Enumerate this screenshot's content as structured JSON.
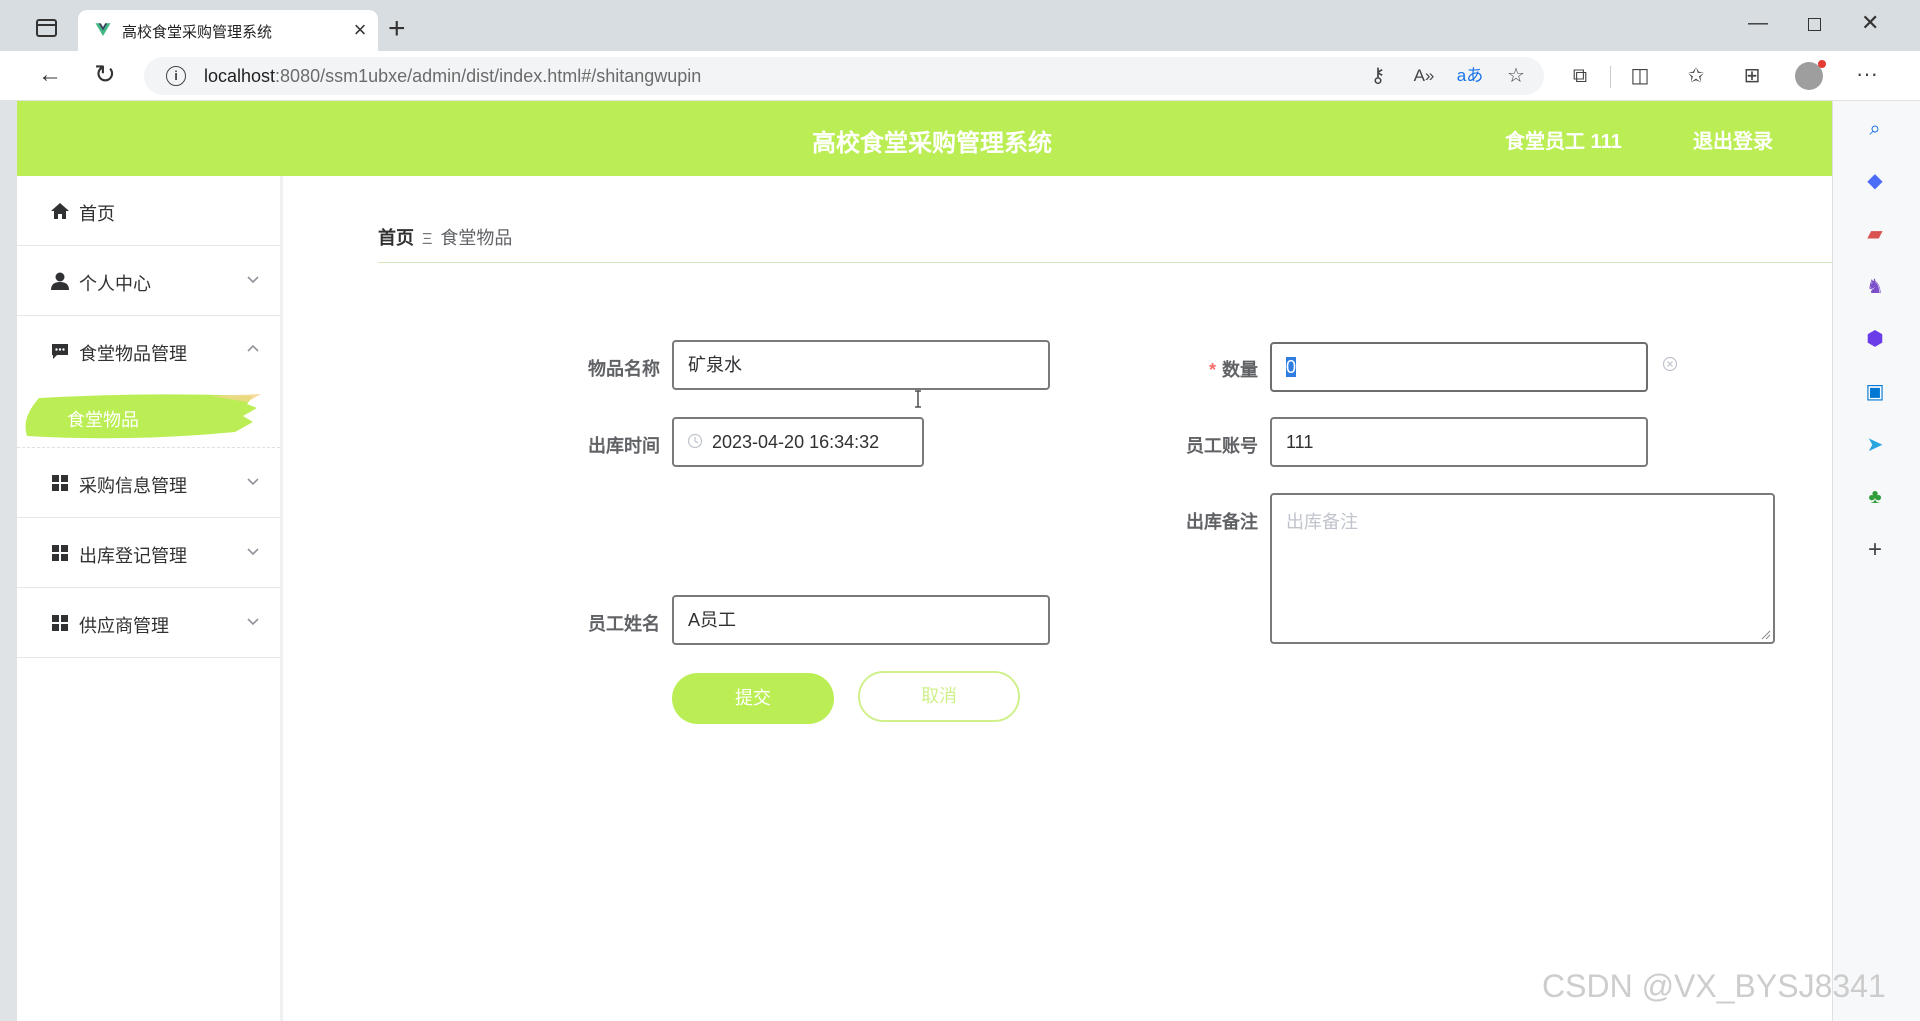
{
  "browser": {
    "tab_title": "高校食堂采购管理系统",
    "url_host": "localhost",
    "url_rest": ":8080/ssm1ubxe/admin/dist/index.html#/shitangwupin"
  },
  "header": {
    "title": "高校食堂采购管理系统",
    "user": "食堂员工 111",
    "logout": "退出登录"
  },
  "menu": {
    "items": [
      {
        "label": "首页",
        "icon": "home-icon"
      },
      {
        "label": "个人中心",
        "icon": "user-icon"
      },
      {
        "label": "食堂物品管理",
        "icon": "chat-icon"
      },
      {
        "label": "采购信息管理",
        "icon": "grid-icon"
      },
      {
        "label": "出库登记管理",
        "icon": "grid-icon"
      },
      {
        "label": "供应商管理",
        "icon": "grid-icon"
      }
    ],
    "active_sub": "食堂物品"
  },
  "breadcrumb": {
    "home": "首页",
    "separator": "Ξ",
    "current": "食堂物品"
  },
  "form": {
    "item_name": {
      "label": "物品名称",
      "value": "矿泉水"
    },
    "quantity": {
      "label": "数量",
      "required_mark": "*",
      "value": "0"
    },
    "outbound_time": {
      "label": "出库时间",
      "value": "2023-04-20 16:34:32"
    },
    "employee_account": {
      "label": "员工账号",
      "value": "111"
    },
    "remark": {
      "label": "出库备注",
      "placeholder": "出库备注",
      "value": ""
    },
    "employee_name": {
      "label": "员工姓名",
      "value": "A员工"
    },
    "submit": "提交",
    "cancel": "取消"
  },
  "watermark": "CSDN @VX_BYSJ8341",
  "colors": {
    "accent": "#bbee55",
    "accent_light": "#cff08a"
  }
}
